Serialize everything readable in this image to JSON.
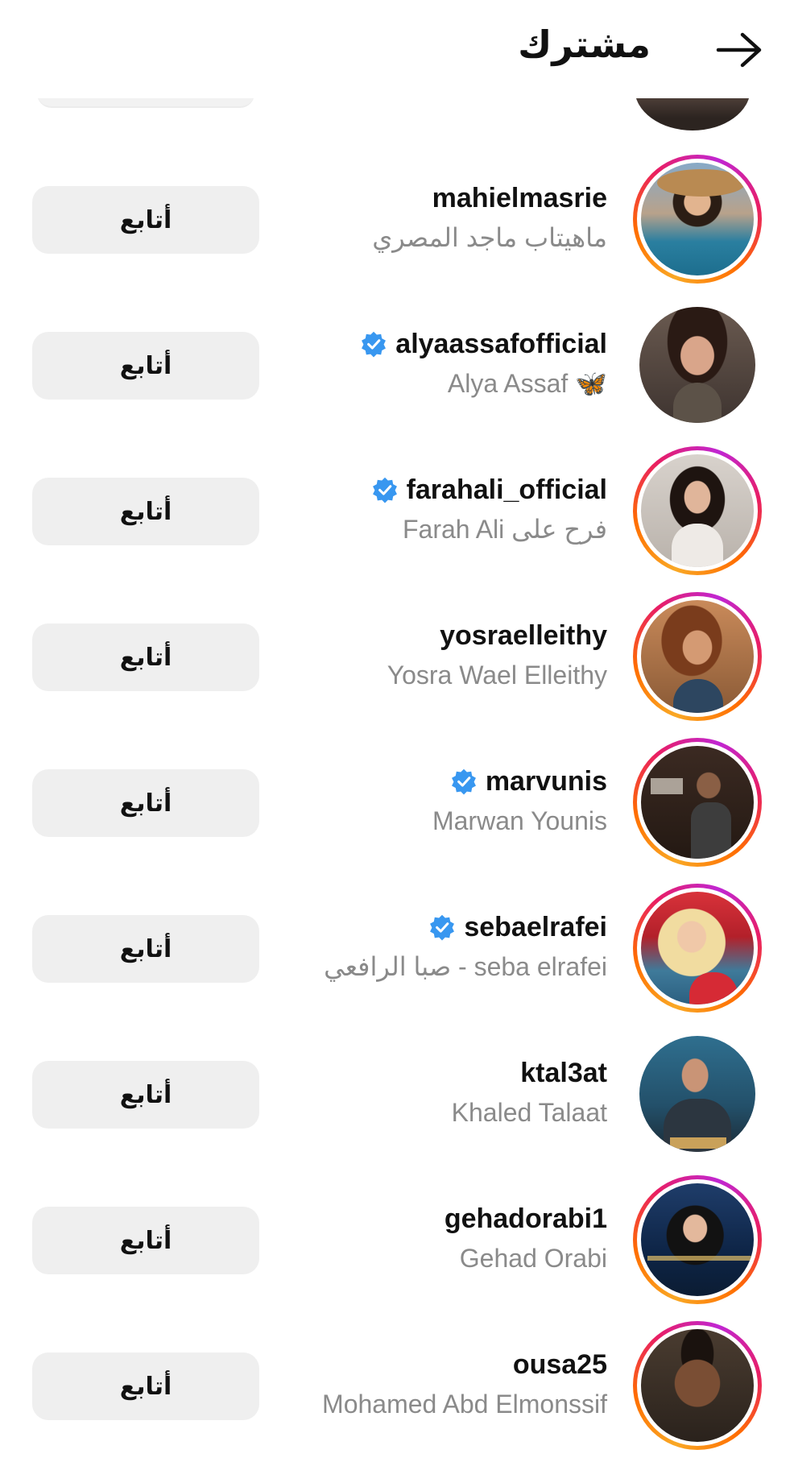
{
  "header": {
    "title": "مشترك",
    "back_icon": "arrow-right-icon"
  },
  "follow_label": "أتابع",
  "accounts": [
    {
      "username": "mahielmasrie",
      "name": "ماهيتاب ماجد المصري",
      "verified": false,
      "story": true
    },
    {
      "username": "alyaassafofficial",
      "name": "Alya Assaf 🦋",
      "verified": true,
      "story": false
    },
    {
      "username": "farahali_official",
      "name": "Farah Ali فرح على",
      "verified": true,
      "story": true
    },
    {
      "username": "yosraelleithy",
      "name": "Yosra Wael Elleithy",
      "verified": false,
      "story": true
    },
    {
      "username": "marvunis",
      "name": "Marwan Younis",
      "verified": true,
      "story": true
    },
    {
      "username": "sebaelrafei",
      "name": "seba elrafei - صبا الرافعي",
      "verified": true,
      "story": true
    },
    {
      "username": "ktal3at",
      "name": "Khaled Talaat",
      "verified": false,
      "story": false
    },
    {
      "username": "gehadorabi1",
      "name": "Gehad Orabi",
      "verified": false,
      "story": true
    },
    {
      "username": "ousa25",
      "name": "Mohamed Abd Elmonssif",
      "verified": false,
      "story": true
    }
  ],
  "colors": {
    "verified_badge": "#3897f0",
    "button_bg": "#efefef",
    "secondary_text": "#8a8a8a"
  }
}
